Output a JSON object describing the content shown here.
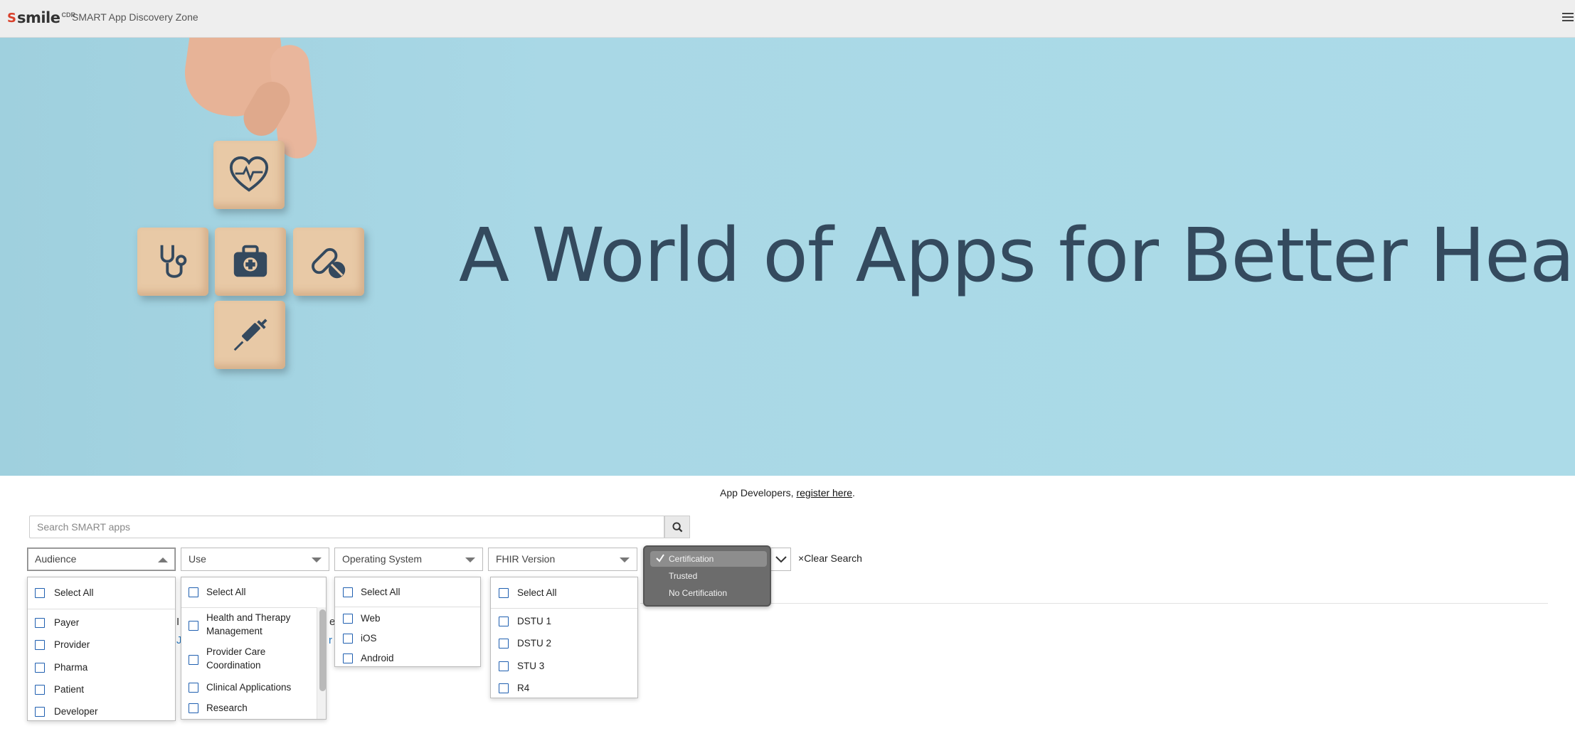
{
  "header": {
    "logo_mark": "S",
    "logo_word": "smile",
    "logo_cdr": "CDR",
    "app_title": "SMART App Discovery Zone"
  },
  "hero": {
    "title": "A World of Apps for Better Health",
    "blocks": [
      "heart-icon",
      "stethoscope-icon",
      "first-aid-kit-icon",
      "pill-icon",
      "syringe-icon"
    ]
  },
  "register": {
    "prefix": "App Developers, ",
    "link": "register here",
    "suffix": "."
  },
  "search": {
    "placeholder": "Search SMART apps"
  },
  "filters": {
    "audience": {
      "label": "Audience",
      "options": [
        "Select All",
        "Payer",
        "Provider",
        "Pharma",
        "Patient",
        "Developer"
      ]
    },
    "use": {
      "label": "Use",
      "options": [
        "Select All",
        "Health and Therapy",
        "Management",
        "Provider Care",
        "Coordination",
        "Clinical Applications",
        "Research"
      ]
    },
    "os": {
      "label": "Operating System",
      "options": [
        "Select All",
        "Web",
        "iOS",
        "Android"
      ]
    },
    "fhir": {
      "label": "FHIR Version",
      "options": [
        "Select All",
        "DSTU 1",
        "DSTU 2",
        "STU 3",
        "R4"
      ]
    },
    "certification": {
      "options": [
        "Certification",
        "Trusted",
        "No Certification"
      ],
      "selected": "Certification"
    },
    "clear_label": "Clear Search",
    "clear_mark": "×"
  },
  "peek": {
    "a": "I",
    "b": "J",
    "c": "e",
    "d": "r"
  },
  "colors": {
    "hero_bg": "#acdbe8",
    "hero_text": "#344a5e",
    "checkbox": "#1f5fb0",
    "logo_red": "#d9402b"
  }
}
